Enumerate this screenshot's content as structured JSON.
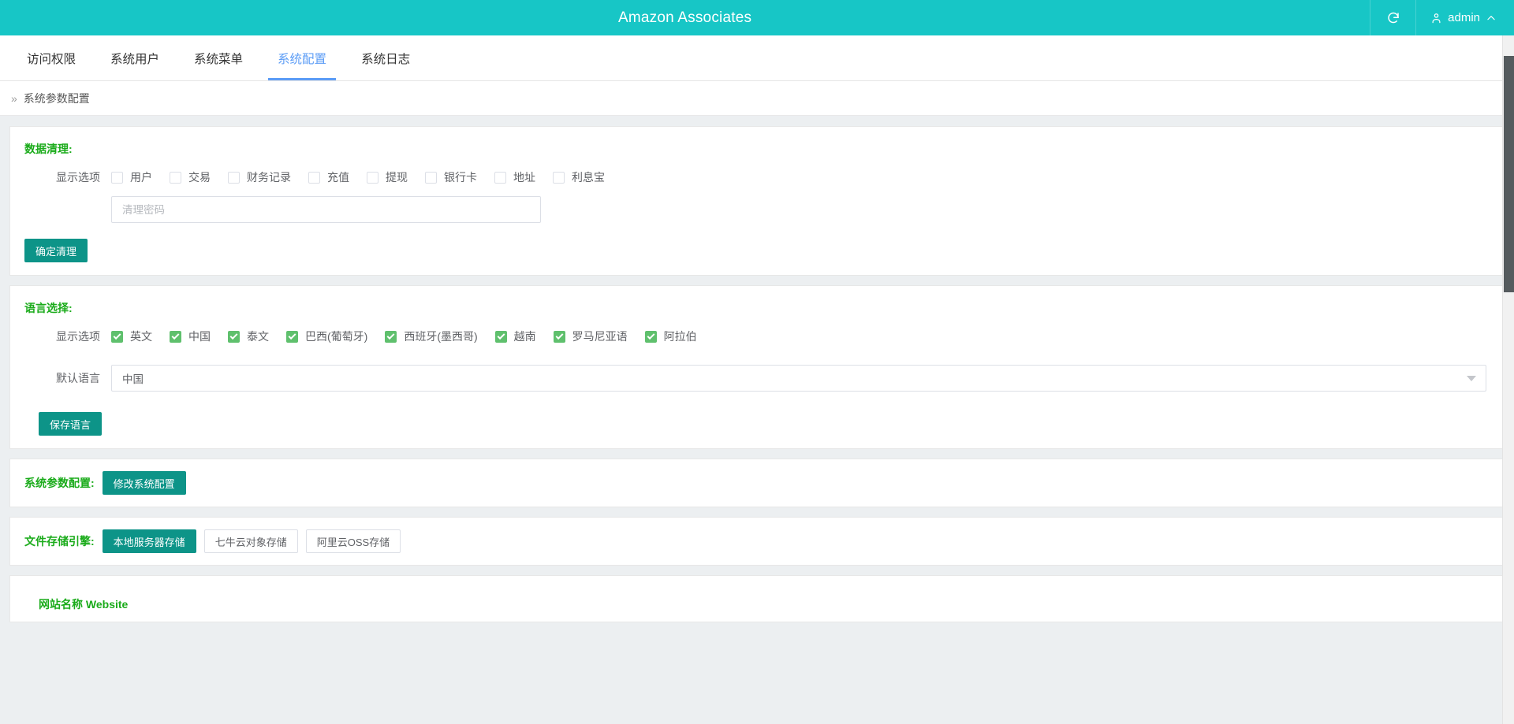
{
  "header": {
    "title": "Amazon Associates",
    "refresh_icon": "refresh-icon",
    "user_icon": "person-icon",
    "username": "admin",
    "chevron_icon": "chevron-up-icon",
    "bg_color": "#17c6c6"
  },
  "tabs": [
    {
      "label": "访问权限",
      "active": false
    },
    {
      "label": "系统用户",
      "active": false
    },
    {
      "label": "系统菜单",
      "active": false
    },
    {
      "label": "系统配置",
      "active": true
    },
    {
      "label": "系统日志",
      "active": false
    }
  ],
  "breadcrumb": {
    "chevron": "»",
    "text": "系统参数配置"
  },
  "data_cleanup": {
    "title": "数据清理:",
    "options_label": "显示选项",
    "options": [
      {
        "label": "用户",
        "checked": false
      },
      {
        "label": "交易",
        "checked": false
      },
      {
        "label": "财务记录",
        "checked": false
      },
      {
        "label": "充值",
        "checked": false
      },
      {
        "label": "提现",
        "checked": false
      },
      {
        "label": "银行卡",
        "checked": false
      },
      {
        "label": "地址",
        "checked": false
      },
      {
        "label": "利息宝",
        "checked": false
      }
    ],
    "password_value": "",
    "password_placeholder": "清理密码",
    "confirm_button": "确定清理"
  },
  "language": {
    "title": "语言选择:",
    "options_label": "显示选项",
    "options": [
      {
        "label": "英文",
        "checked": true
      },
      {
        "label": "中国",
        "checked": true
      },
      {
        "label": "泰文",
        "checked": true
      },
      {
        "label": "巴西(葡萄牙)",
        "checked": true
      },
      {
        "label": "西班牙(墨西哥)",
        "checked": true
      },
      {
        "label": "越南",
        "checked": true
      },
      {
        "label": "罗马尼亚语",
        "checked": true
      },
      {
        "label": "阿拉伯",
        "checked": true
      }
    ],
    "default_label": "默认语言",
    "default_value": "中国",
    "save_button": "保存语言"
  },
  "sys_params": {
    "title": "系统参数配置:",
    "edit_button": "修改系统配置"
  },
  "storage": {
    "title": "文件存储引擎:",
    "buttons": [
      {
        "label": "本地服务器存储",
        "active": true
      },
      {
        "label": "七牛云对象存储",
        "active": false
      },
      {
        "label": "阿里云OSS存储",
        "active": false
      }
    ]
  },
  "website": {
    "label": "网站名称 Website"
  },
  "colors": {
    "header": "#17c6c6",
    "accent_green": "#1aab1a",
    "button_teal": "#0d9488",
    "tab_active": "#5b9cf6",
    "checkbox_green": "#5fc06d"
  }
}
